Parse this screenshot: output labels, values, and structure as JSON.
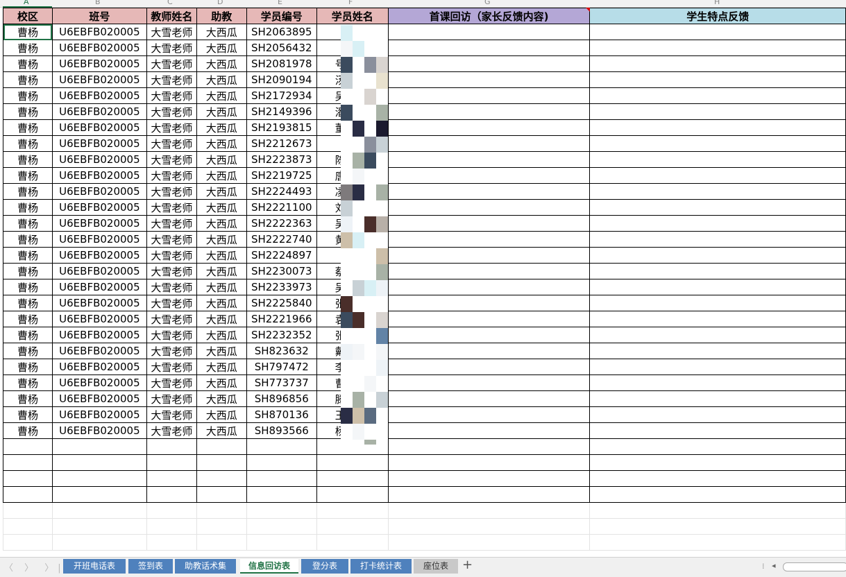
{
  "column_letters": [
    "A",
    "B",
    "C",
    "D",
    "E",
    "F",
    "G",
    "H"
  ],
  "headers": [
    "校区",
    "班号",
    "教师姓名",
    "助教",
    "学员编号",
    "学员姓名",
    "首课回访（家长反馈内容)",
    "学生特点反馈"
  ],
  "rows": [
    [
      "曹杨",
      "U6EBFB020005",
      "大雪老师",
      "大西瓜",
      "SH2063895",
      ""
    ],
    [
      "曹杨",
      "U6EBFB020005",
      "大雪老师",
      "大西瓜",
      "SH2056432",
      ""
    ],
    [
      "曹杨",
      "U6EBFB020005",
      "大雪老师",
      "大西瓜",
      "SH2081978",
      "号"
    ],
    [
      "曹杨",
      "U6EBFB020005",
      "大雪老师",
      "大西瓜",
      "SH2090194",
      "汤"
    ],
    [
      "曹杨",
      "U6EBFB020005",
      "大雪老师",
      "大西瓜",
      "SH2172934",
      "吴"
    ],
    [
      "曹杨",
      "U6EBFB020005",
      "大雪老师",
      "大西瓜",
      "SH2149396",
      "潘"
    ],
    [
      "曹杨",
      "U6EBFB020005",
      "大雪老师",
      "大西瓜",
      "SH2193815",
      "董"
    ],
    [
      "曹杨",
      "U6EBFB020005",
      "大雪老师",
      "大西瓜",
      "SH2212673",
      ""
    ],
    [
      "曹杨",
      "U6EBFB020005",
      "大雪老师",
      "大西瓜",
      "SH2223873",
      "陈"
    ],
    [
      "曹杨",
      "U6EBFB020005",
      "大雪老师",
      "大西瓜",
      "SH2219725",
      "唐"
    ],
    [
      "曹杨",
      "U6EBFB020005",
      "大雪老师",
      "大西瓜",
      "SH2224493",
      "凌"
    ],
    [
      "曹杨",
      "U6EBFB020005",
      "大雪老师",
      "大西瓜",
      "SH2221100",
      "刘"
    ],
    [
      "曹杨",
      "U6EBFB020005",
      "大雪老师",
      "大西瓜",
      "SH2222363",
      "吴"
    ],
    [
      "曹杨",
      "U6EBFB020005",
      "大雪老师",
      "大西瓜",
      "SH2222740",
      "黄"
    ],
    [
      "曹杨",
      "U6EBFB020005",
      "大雪老师",
      "大西瓜",
      "SH2224897",
      ""
    ],
    [
      "曹杨",
      "U6EBFB020005",
      "大雪老师",
      "大西瓜",
      "SH2230073",
      "蔡"
    ],
    [
      "曹杨",
      "U6EBFB020005",
      "大雪老师",
      "大西瓜",
      "SH2233973",
      "吴"
    ],
    [
      "曹杨",
      "U6EBFB020005",
      "大雪老师",
      "大西瓜",
      "SH2225840",
      "张"
    ],
    [
      "曹杨",
      "U6EBFB020005",
      "大雪老师",
      "大西瓜",
      "SH2221966",
      "袁"
    ],
    [
      "曹杨",
      "U6EBFB020005",
      "大雪老师",
      "大西瓜",
      "SH2232352",
      "张"
    ],
    [
      "曹杨",
      "U6EBFB020005",
      "大雪老师",
      "大西瓜",
      "SH823632",
      "戴"
    ],
    [
      "曹杨",
      "U6EBFB020005",
      "大雪老师",
      "大西瓜",
      "SH797472",
      "李"
    ],
    [
      "曹杨",
      "U6EBFB020005",
      "大雪老师",
      "大西瓜",
      "SH773737",
      "曹"
    ],
    [
      "曹杨",
      "U6EBFB020005",
      "大雪老师",
      "大西瓜",
      "SH896856",
      "滕"
    ],
    [
      "曹杨",
      "U6EBFB020005",
      "大雪老师",
      "大西瓜",
      "SH870136",
      "王"
    ],
    [
      "曹杨",
      "U6EBFB020005",
      "大雪老师",
      "大西瓜",
      "SH893566",
      "杨"
    ]
  ],
  "sheet_tabs": [
    {
      "label": "开班电话表",
      "state": "normal"
    },
    {
      "label": "签到表",
      "state": "normal"
    },
    {
      "label": "助教话术集",
      "state": "normal"
    },
    {
      "label": "信息回访表",
      "state": "active"
    },
    {
      "label": "登分表",
      "state": "normal"
    },
    {
      "label": "打卡统计表",
      "state": "normal"
    },
    {
      "label": "座位表",
      "state": "gray"
    }
  ],
  "add_sheet_label": "+",
  "nav_arrows": "〈 〉 〉|",
  "colors": {
    "header_pink": "#e6b8b7",
    "header_purple": "#b4a7d6",
    "header_blue": "#b7dde8",
    "tab_blue": "#4f81bd",
    "active_green": "#217346"
  }
}
